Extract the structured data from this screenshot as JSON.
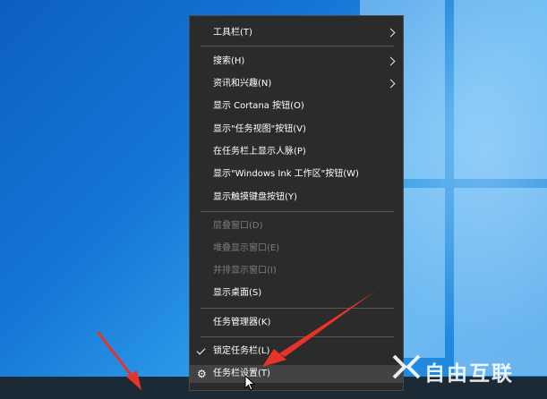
{
  "menu": {
    "items": [
      {
        "label": "工具栏(T)",
        "submenu": true,
        "disabled": false
      },
      {
        "label": "搜索(H)",
        "submenu": true,
        "disabled": false
      },
      {
        "label": "资讯和兴趣(N)",
        "submenu": true,
        "disabled": false
      },
      {
        "label": "显示 Cortana 按钮(O)",
        "submenu": false,
        "disabled": false
      },
      {
        "label": "显示\"任务视图\"按钮(V)",
        "submenu": false,
        "disabled": false
      },
      {
        "label": "在任务栏上显示人脉(P)",
        "submenu": false,
        "disabled": false
      },
      {
        "label": "显示\"Windows Ink 工作区\"按钮(W)",
        "submenu": false,
        "disabled": false
      },
      {
        "label": "显示触摸键盘按钮(Y)",
        "submenu": false,
        "disabled": false
      },
      {
        "label": "层叠窗口(D)",
        "submenu": false,
        "disabled": true
      },
      {
        "label": "堆叠显示窗口(E)",
        "submenu": false,
        "disabled": true
      },
      {
        "label": "并排显示窗口(I)",
        "submenu": false,
        "disabled": true
      },
      {
        "label": "显示桌面(S)",
        "submenu": false,
        "disabled": false
      },
      {
        "label": "任务管理器(K)",
        "submenu": false,
        "disabled": false
      },
      {
        "label": "锁定任务栏(L)",
        "submenu": false,
        "disabled": false,
        "checked": true
      },
      {
        "label": "任务栏设置(T)",
        "submenu": false,
        "disabled": false,
        "icon": "gear-icon",
        "highlighted": true
      }
    ]
  },
  "watermark": {
    "text": "自由互联"
  },
  "colors": {
    "menu_bg": "#2b2b2b",
    "annotation_arrow": "#e8332a",
    "desktop_blue": "#1576d6",
    "taskbar": "#1c2a36"
  }
}
